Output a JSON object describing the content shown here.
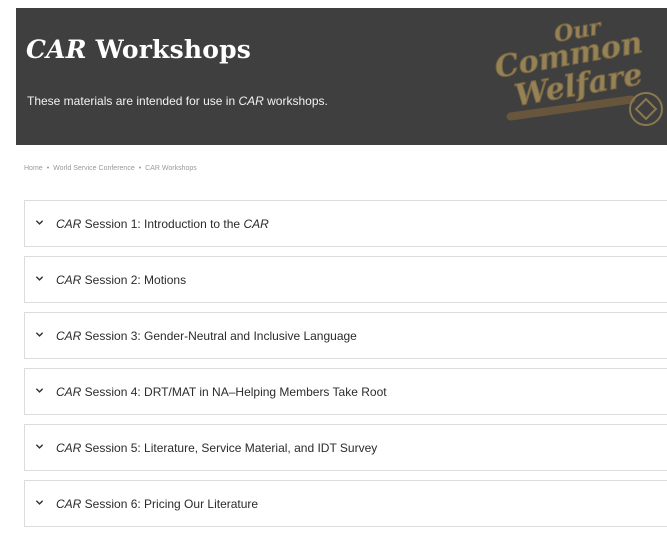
{
  "header": {
    "title_em": "CAR",
    "title_rest": " Workshops",
    "subtitle_before": "These materials are intended for use in ",
    "subtitle_em": "CAR",
    "subtitle_after": " workshops.",
    "logo": {
      "line1": "Our",
      "line2": "Common",
      "line3": "Welfare"
    },
    "background_color": "#3f3f3f"
  },
  "breadcrumb": {
    "items": [
      "Home",
      "World Service Conference",
      "CAR Workshops"
    ],
    "separator": "•"
  },
  "sessions": [
    {
      "prefix": "CAR",
      "label": " Session 1: Introduction to the ",
      "suffix_em": "CAR"
    },
    {
      "prefix": "CAR",
      "label": " Session 2: Motions",
      "suffix_em": ""
    },
    {
      "prefix": "CAR",
      "label": " Session 3: Gender-Neutral and Inclusive Language",
      "suffix_em": ""
    },
    {
      "prefix": "CAR",
      "label": " Session 4: DRT/MAT in NA–Helping Members Take Root",
      "suffix_em": ""
    },
    {
      "prefix": "CAR",
      "label": " Session 5: Literature, Service Material, and IDT Survey",
      "suffix_em": ""
    },
    {
      "prefix": "CAR",
      "label": " Session 6: Pricing Our Literature",
      "suffix_em": ""
    }
  ]
}
